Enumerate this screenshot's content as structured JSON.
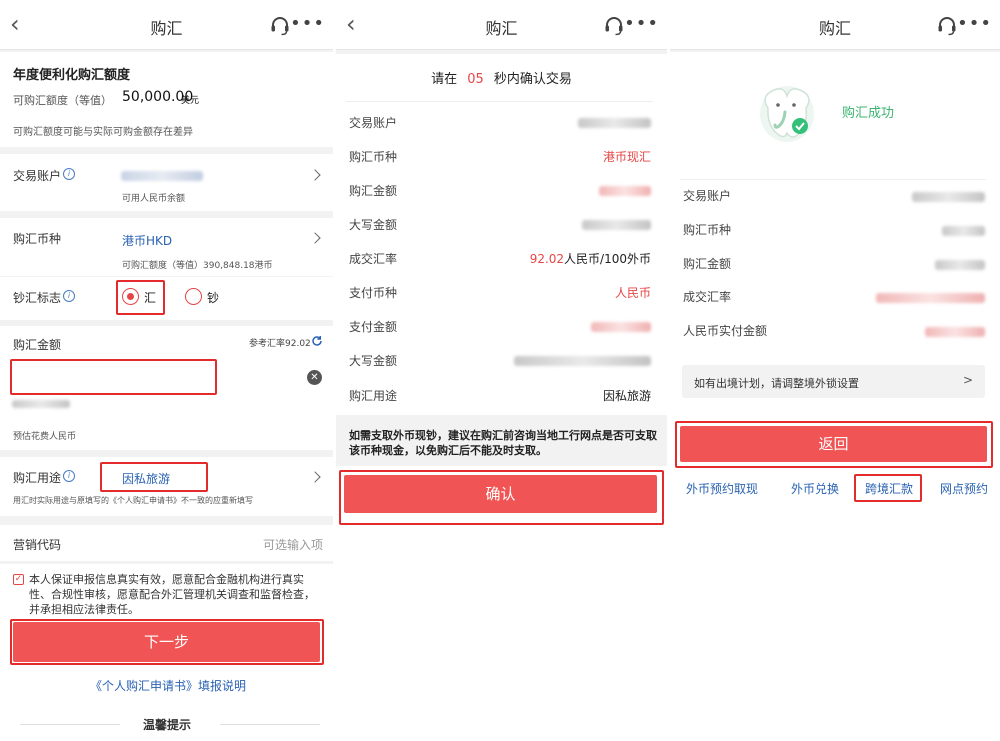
{
  "panel1": {
    "nav_title": "购汇",
    "quota_title": "年度便利化购汇额度",
    "quota_label": "可购汇额度（等值）",
    "quota_value": "50,000.00",
    "quota_unit": "美元",
    "quota_note": "可购汇额度可能与实际可购金额存在差异",
    "account_label": "交易账户",
    "account_sub": "可用人民币余额",
    "currency_label": "购汇币种",
    "currency_value": "港币HKD",
    "currency_sub": "可购汇额度（等值）390,848.18港币",
    "flag_label": "钞汇标志",
    "flag_option1": "汇",
    "flag_option2": "钞",
    "amount_label": "购汇金额",
    "ref_rate": "参考汇率92.02",
    "estimate_label": "预估花费人民币",
    "purpose_label": "购汇用途",
    "purpose_value": "因私旅游",
    "purpose_note": "用汇时实际用途与原填写的《个人购汇申请书》不一致的应重新填写",
    "promo_label": "营销代码",
    "promo_placeholder": "可选输入项",
    "agreement": "本人保证申报信息真实有效，愿意配合金融机构进行真实性、合规性审核，愿意配合外汇管理机关调查和监督检查，并承担相应法律责任。",
    "next_button": "下一步",
    "form_help_link": "《个人购汇申请书》填报说明",
    "tips_title": "温馨提示"
  },
  "panel2": {
    "nav_title": "购汇",
    "countdown_prefix": "请在",
    "countdown_value": "05",
    "countdown_suffix": "秒内确认交易",
    "rows": [
      {
        "label": "交易账户"
      },
      {
        "label": "购汇币种",
        "value": "港币现汇"
      },
      {
        "label": "购汇金额"
      },
      {
        "label": "大写金额"
      },
      {
        "label": "成交汇率",
        "value_red": "92.02",
        "value": "人民币/100外币"
      },
      {
        "label": "支付币种",
        "value": "人民币"
      },
      {
        "label": "支付金额"
      },
      {
        "label": "大写金额"
      },
      {
        "label": "购汇用途",
        "value": "因私旅游"
      }
    ],
    "notice": "如需支取外币现钞，建议在购汇前咨询当地工行网点是否可支取该币种现金，以免购汇后不能及时支取。",
    "confirm_button": "确认"
  },
  "panel3": {
    "nav_title": "购汇",
    "success_text": "购汇成功",
    "rows": [
      {
        "label": "交易账户"
      },
      {
        "label": "购汇币种"
      },
      {
        "label": "购汇金额"
      },
      {
        "label": "成交汇率"
      },
      {
        "label": "人民币实付金额"
      }
    ],
    "outbound_text": "如有出境计划，请调整境外锁设置",
    "return_button": "返回",
    "links": [
      "外币预约取现",
      "外币兑换",
      "跨境汇款",
      "网点预约"
    ]
  },
  "colors": {
    "accent_red": "#f15454",
    "highlight_red": "#e32b2b",
    "link_blue": "#2a62b3",
    "success_green": "#3cb371"
  }
}
